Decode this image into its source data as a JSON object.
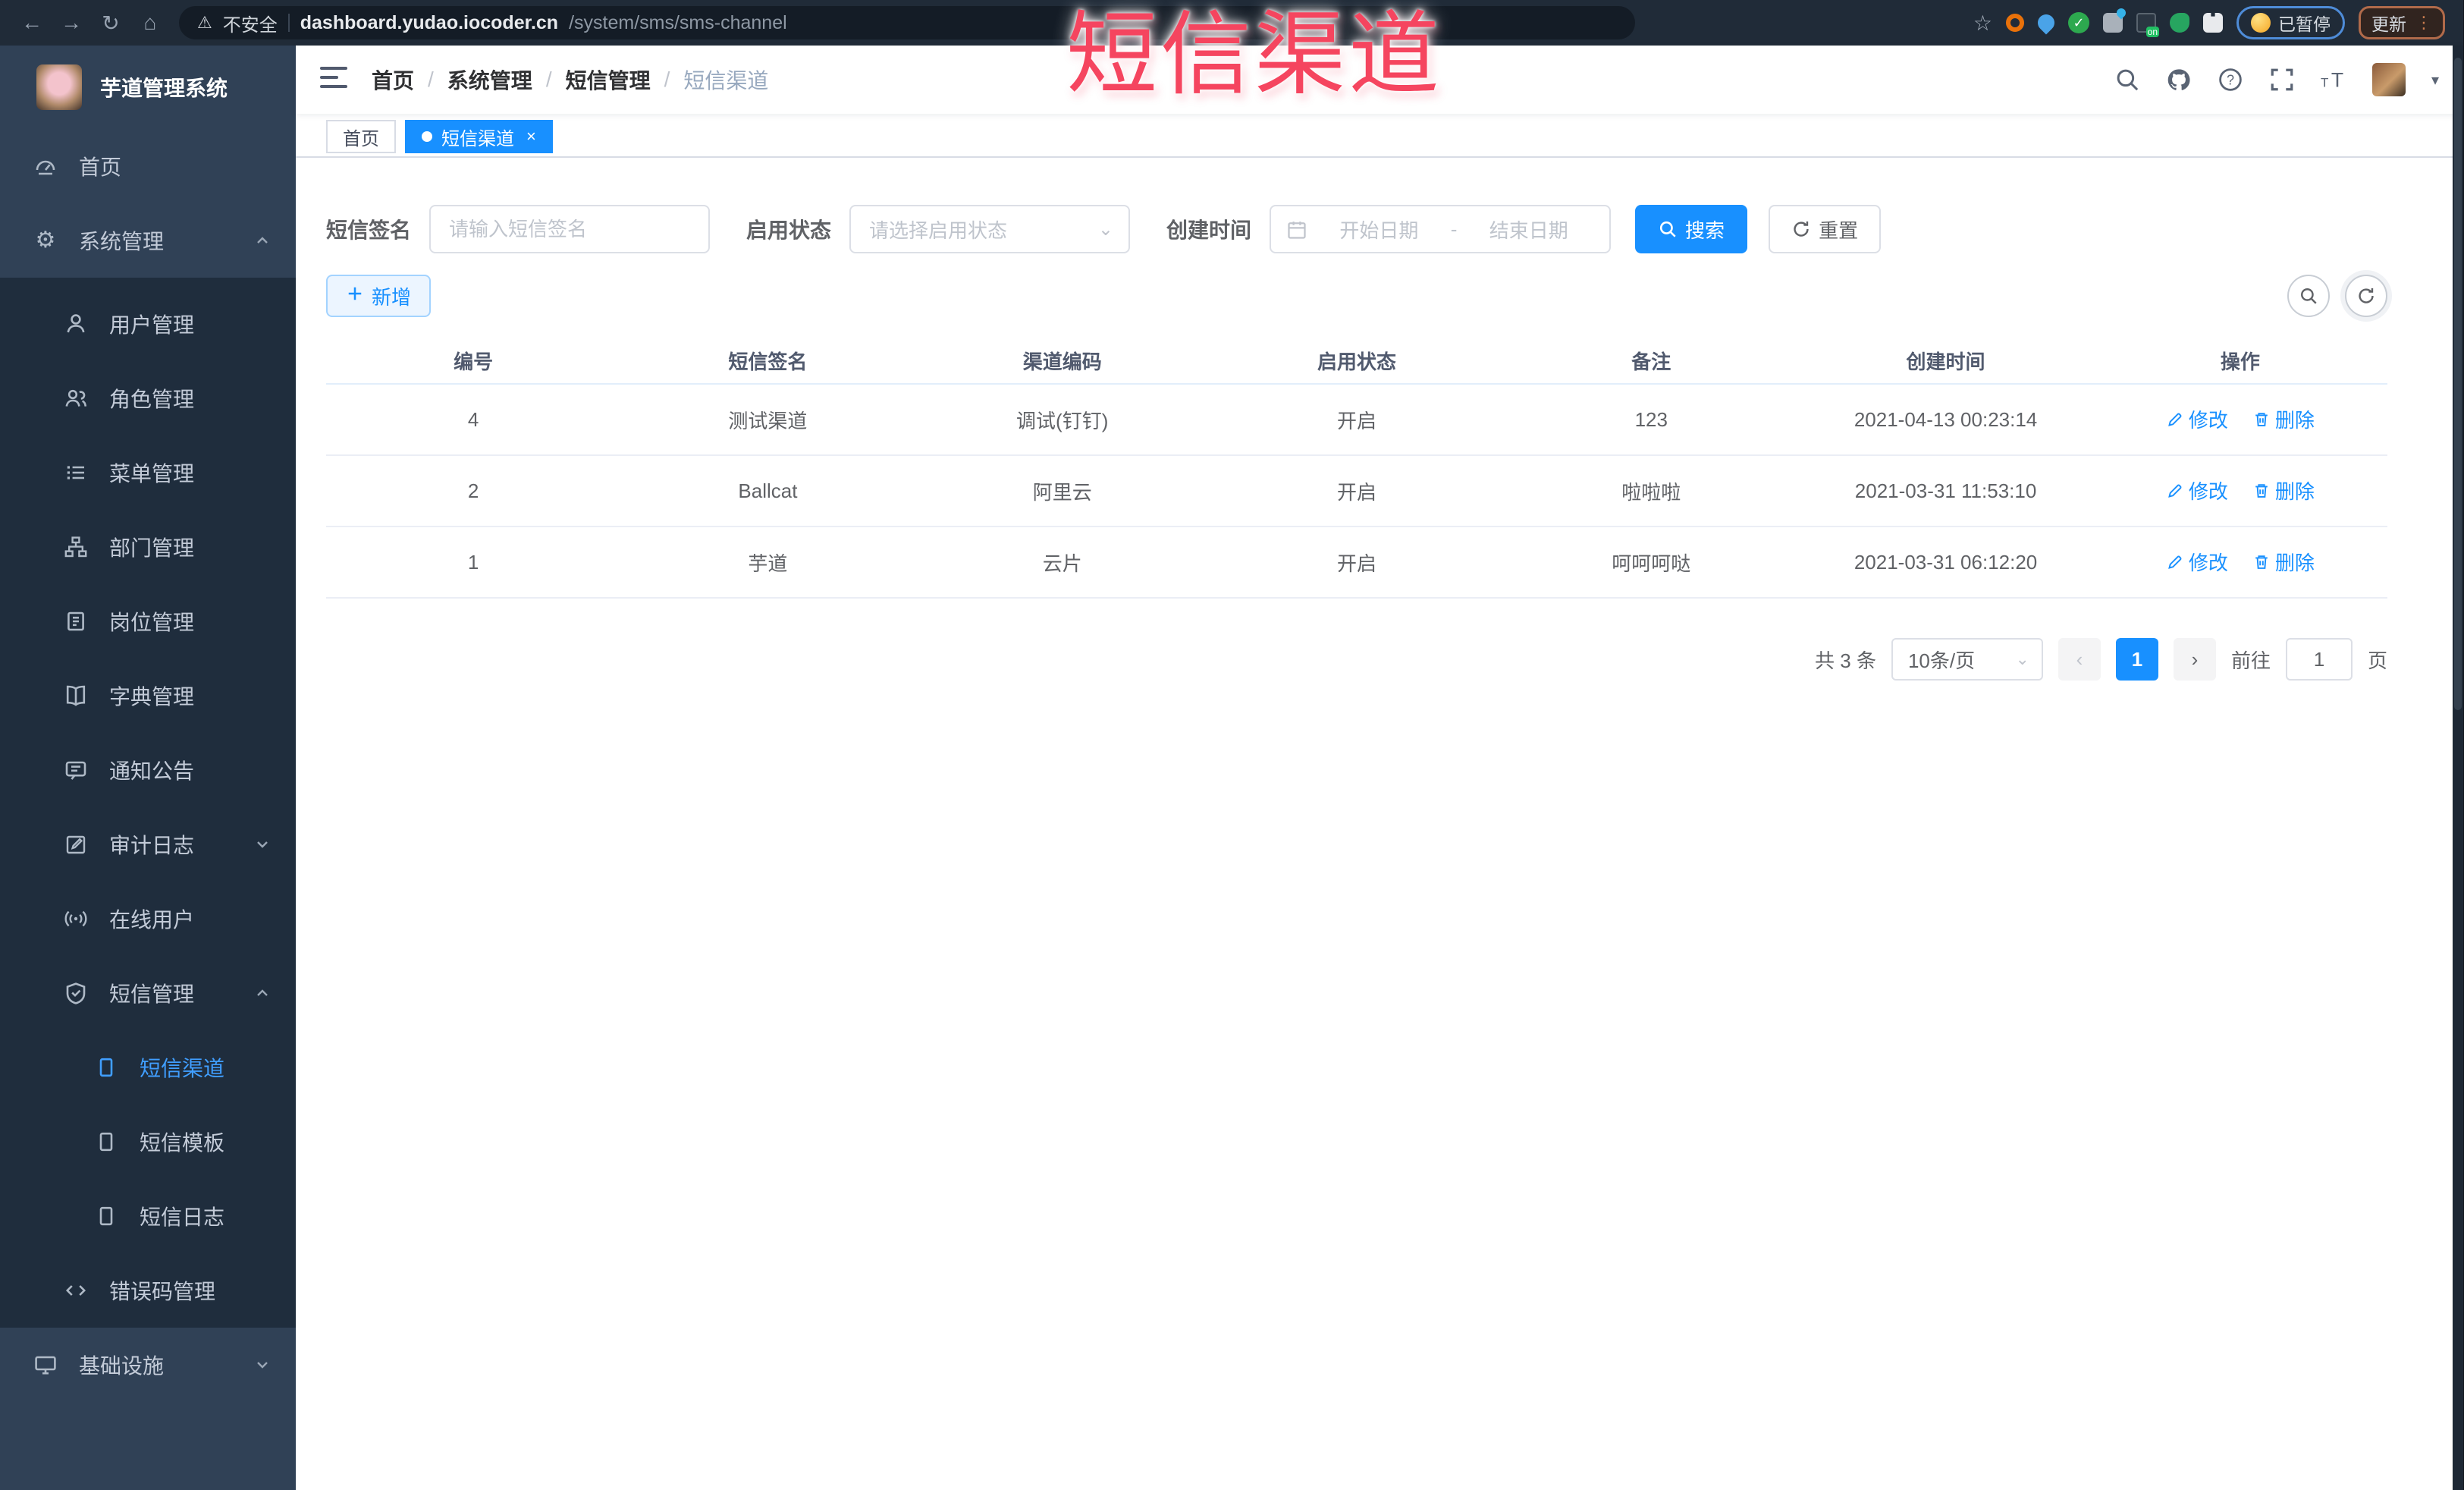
{
  "colors": {
    "accent": "#1890ff",
    "sidebar_bg": "#304156",
    "sidebar_submenu_bg": "#1f2d3d",
    "sidebar_active_text": "#409eff",
    "chrome_bg": "#202b38",
    "watermark_red": "#f5455f",
    "tab_active_bg": "#1890ff",
    "add_button_bg": "#ecf5ff"
  },
  "icons": {
    "back": "←",
    "forward": "→",
    "reload": "↻",
    "home": "⌂",
    "warning": "⚠",
    "star": "☆",
    "caret_down": "▾",
    "chevron_select": "⌄",
    "gear": "⚙",
    "code": "</>",
    "dots": "⋮"
  },
  "browser": {
    "security": "不安全",
    "url_host": "dashboard.yudao.iocoder.cn",
    "url_path": "/system/sms/sms-channel",
    "paused": "已暂停",
    "update": "更新"
  },
  "watermark": {
    "text": "短信渠道"
  },
  "sidebar": {
    "logo_title": "芋道管理系统",
    "items": [
      {
        "label": "首页"
      },
      {
        "label": "系统管理"
      },
      {
        "label": "用户管理"
      },
      {
        "label": "角色管理"
      },
      {
        "label": "菜单管理"
      },
      {
        "label": "部门管理"
      },
      {
        "label": "岗位管理"
      },
      {
        "label": "字典管理"
      },
      {
        "label": "通知公告"
      },
      {
        "label": "审计日志"
      },
      {
        "label": "在线用户"
      },
      {
        "label": "短信管理"
      },
      {
        "label": "短信渠道"
      },
      {
        "label": "短信模板"
      },
      {
        "label": "短信日志"
      },
      {
        "label": "错误码管理"
      },
      {
        "label": "基础设施"
      }
    ]
  },
  "breadcrumb": {
    "separator": "/",
    "items": [
      "首页",
      "系统管理",
      "短信管理",
      "短信渠道"
    ]
  },
  "tabs": [
    {
      "label": "首页"
    },
    {
      "label": "短信渠道",
      "close": "×"
    }
  ],
  "filters": {
    "sign_label": "短信签名",
    "sign_placeholder": "请输入短信签名",
    "status_label": "启用状态",
    "status_placeholder": "请选择启用状态",
    "time_label": "创建时间",
    "start_placeholder": "开始日期",
    "range_separator": "-",
    "end_placeholder": "结束日期",
    "search": "搜索",
    "reset": "重置"
  },
  "toolbar": {
    "add": "新增"
  },
  "table": {
    "headers": [
      "编号",
      "短信签名",
      "渠道编码",
      "启用状态",
      "备注",
      "创建时间",
      "操作"
    ],
    "edit": "修改",
    "delete": "删除",
    "rows": [
      {
        "id": "4",
        "sign": "测试渠道",
        "code": "调试(钉钉)",
        "status": "开启",
        "remark": "123",
        "created": "2021-04-13 00:23:14"
      },
      {
        "id": "2",
        "sign": "Ballcat",
        "code": "阿里云",
        "status": "开启",
        "remark": "啦啦啦",
        "created": "2021-03-31 11:53:10"
      },
      {
        "id": "1",
        "sign": "芋道",
        "code": "云片",
        "status": "开启",
        "remark": "呵呵呵哒",
        "created": "2021-03-31 06:12:20"
      }
    ]
  },
  "pagination": {
    "total": "共 3 条",
    "page_size": "10条/页",
    "prev": "‹",
    "page": "1",
    "next": "›",
    "goto": "前往",
    "goto_value": "1",
    "unit": "页"
  }
}
